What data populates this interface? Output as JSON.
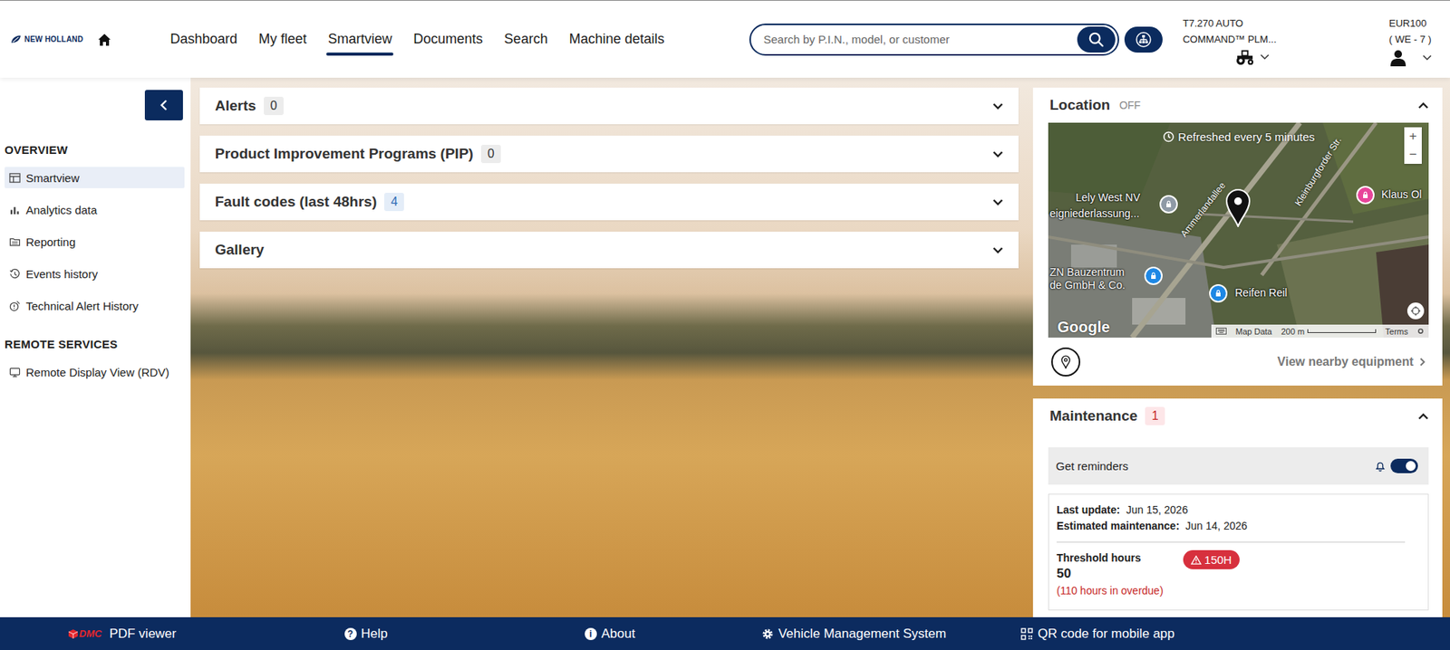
{
  "brand": {
    "name": "NEW HOLLAND"
  },
  "nav": [
    {
      "label": "Dashboard",
      "selected": false
    },
    {
      "label": "My fleet",
      "selected": false
    },
    {
      "label": "Smartview",
      "selected": true
    },
    {
      "label": "Documents",
      "selected": false
    },
    {
      "label": "Search",
      "selected": false
    },
    {
      "label": "Machine details",
      "selected": false
    }
  ],
  "search": {
    "placeholder": "Search by P.I.N., model, or customer"
  },
  "machine": {
    "model": "T7.270 AUTO",
    "variant": "COMMAND™ PLM..."
  },
  "account": {
    "dealer": "EUR100",
    "region": "( WE - 7 )"
  },
  "sidebar": {
    "sections": [
      {
        "title": "OVERVIEW",
        "items": [
          {
            "label": "Smartview",
            "selected": true
          },
          {
            "label": "Analytics data",
            "selected": false
          },
          {
            "label": "Reporting",
            "selected": false
          },
          {
            "label": "Events history",
            "selected": false
          },
          {
            "label": "Technical Alert History",
            "selected": false
          }
        ]
      },
      {
        "title": "REMOTE SERVICES",
        "items": [
          {
            "label": "Remote Display View (RDV)",
            "selected": false
          }
        ]
      }
    ]
  },
  "panels": [
    {
      "title": "Alerts",
      "count": "0",
      "expanded": false,
      "color": "#333333"
    },
    {
      "title": "Product Improvement Programs (PIP)",
      "count": "0",
      "expanded": false,
      "color": "#333333"
    },
    {
      "title": "Fault codes (last 48hrs)",
      "count": "4",
      "expanded": false,
      "color": "#2f6db5"
    },
    {
      "title": "Gallery",
      "expanded": false
    }
  ],
  "location": {
    "title": "Location",
    "status": "OFF",
    "expanded": true,
    "map": {
      "notice": "Refreshed every 5 minutes",
      "zoom": [
        "+",
        "−"
      ],
      "places": [
        {
          "name": "Lely West NV",
          "color": "#8f9aa6"
        },
        {
          "name": "Klaus Ol",
          "color": "#e8459a"
        },
        {
          "name": "ZN Bauzentrum",
          "color": "#1e88e5"
        },
        {
          "name": "Reifen Reil",
          "color": "#1e88e5"
        }
      ],
      "labels": [
        "eigniederlassung...",
        "de GmbH & Co."
      ],
      "streets": [
        "Ammerlandallee",
        "Kleinburgforder Str."
      ],
      "attribution": {
        "logo": "Google",
        "data": "Map Data",
        "scale": "200 m",
        "terms": "Terms"
      }
    },
    "link": "View nearby equipment"
  },
  "maintenance": {
    "title": "Maintenance",
    "count": "1",
    "expanded": true,
    "reminders": {
      "label": "Get reminders",
      "on": true
    },
    "last_update": {
      "label": "Last update:",
      "value": "Jun 15, 2026"
    },
    "estimated": {
      "label": "Estimated maintenance:",
      "value": "Jun 14, 2026"
    },
    "threshold": {
      "label": "Threshold hours",
      "value": "50",
      "overdue": "(110 hours in overdue)",
      "badge": "150H"
    }
  },
  "footer": [
    {
      "kind": "logo",
      "logo": "DMC",
      "label": "PDF viewer"
    },
    {
      "kind": "glyph",
      "icon": "?",
      "label": "Help"
    },
    {
      "kind": "glyph",
      "icon": "i",
      "label": "About"
    },
    {
      "kind": "gear",
      "label": "Vehicle Management System"
    },
    {
      "kind": "qr",
      "label": "QR code for mobile app"
    }
  ]
}
